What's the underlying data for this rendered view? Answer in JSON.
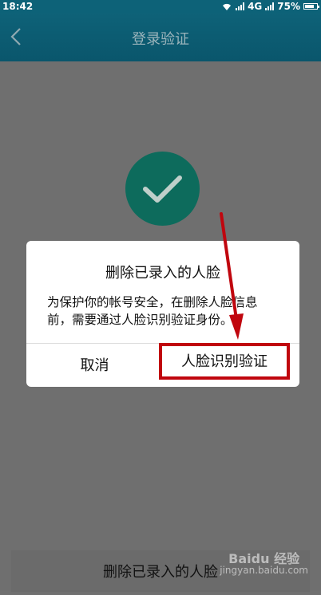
{
  "status_bar": {
    "time": "18:42",
    "network": "4G",
    "battery_percent": "75%",
    "battery_level": 0.75
  },
  "app_bar": {
    "title": "登录验证",
    "back_icon": "chevron-left-icon"
  },
  "success_icon": "check-icon",
  "dialog": {
    "title": "删除已录入的人脸",
    "message": "为保护你的帐号安全，在删除人脸信息前，需要通过人脸识别验证身份。",
    "cancel_label": "取消",
    "verify_label": "人脸识别验证"
  },
  "bottom_button_label": "删除已录入的人脸",
  "watermark": {
    "main": "Baidu 经验",
    "sub": "jingyan.baidu.com"
  },
  "colors": {
    "app_bar": "#0e6278",
    "success": "#0d6b5c",
    "highlight": "#c0060e"
  }
}
